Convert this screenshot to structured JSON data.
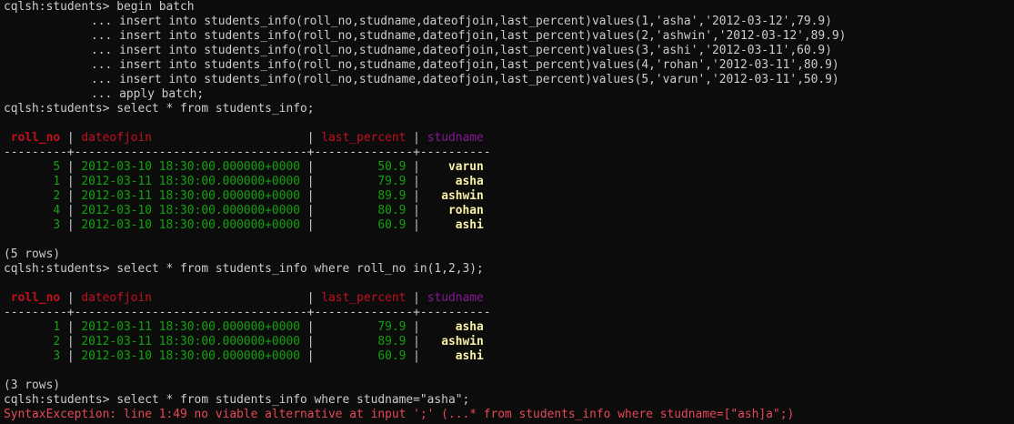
{
  "prompt": "cqlsh:students>",
  "batch": {
    "begin_cmd": "begin batch",
    "continuation": "...",
    "statements": [
      "insert into students_info(roll_no,studname,dateofjoin,last_percent)values(1,'asha','2012-03-12',79.9)",
      "insert into students_info(roll_no,studname,dateofjoin,last_percent)values(2,'ashwin','2012-03-12',89.9)",
      "insert into students_info(roll_no,studname,dateofjoin,last_percent)values(3,'ashi','2012-03-11',60.9)",
      "insert into students_info(roll_no,studname,dateofjoin,last_percent)values(4,'rohan','2012-03-11',80.9)",
      "insert into students_info(roll_no,studname,dateofjoin,last_percent)values(5,'varun','2012-03-11',50.9)",
      "apply batch;"
    ]
  },
  "colors": {
    "background": "#0c0c0c",
    "text": "#cccccc",
    "header_red": "#c50f1f",
    "header_purple": "#881798",
    "number_green": "#13a10e",
    "string_yellow": "#f9f1a5",
    "error_red": "#e74856"
  },
  "query1": {
    "command": "select * from students_info;",
    "columns": [
      "roll_no",
      "dateofjoin",
      "last_percent",
      "studname"
    ],
    "rows": [
      [
        "5",
        "2012-03-10 18:30:00.000000+0000",
        "50.9",
        "varun"
      ],
      [
        "1",
        "2012-03-11 18:30:00.000000+0000",
        "79.9",
        "asha"
      ],
      [
        "2",
        "2012-03-11 18:30:00.000000+0000",
        "89.9",
        "ashwin"
      ],
      [
        "4",
        "2012-03-10 18:30:00.000000+0000",
        "80.9",
        "rohan"
      ],
      [
        "3",
        "2012-03-10 18:30:00.000000+0000",
        "60.9",
        "ashi"
      ]
    ],
    "row_count": "(5 rows)"
  },
  "query2": {
    "command": "select * from students_info where roll_no in(1,2,3);",
    "columns": [
      "roll_no",
      "dateofjoin",
      "last_percent",
      "studname"
    ],
    "rows": [
      [
        "1",
        "2012-03-11 18:30:00.000000+0000",
        "79.9",
        "asha"
      ],
      [
        "2",
        "2012-03-11 18:30:00.000000+0000",
        "89.9",
        "ashwin"
      ],
      [
        "3",
        "2012-03-10 18:30:00.000000+0000",
        "60.9",
        "ashi"
      ]
    ],
    "row_count": "(3 rows)"
  },
  "query3": {
    "command": "select * from students_info where studname=\"asha\";",
    "error": "SyntaxException: line 1:49 no viable alternative at input ';' (...* from students_info where studname=[\"ash]a\";)"
  }
}
